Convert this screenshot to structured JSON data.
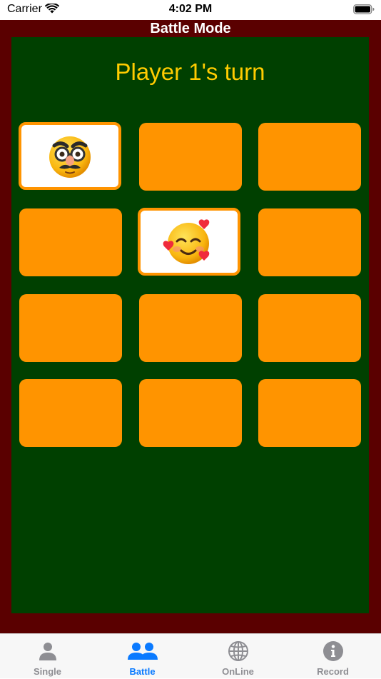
{
  "status_bar": {
    "carrier": "Carrier",
    "time": "4:02 PM"
  },
  "screen": {
    "title": "Battle Mode",
    "turn_text": "Player 1's turn"
  },
  "cards": [
    {
      "face_up": true,
      "emoji": "disguised-face"
    },
    {
      "face_up": false
    },
    {
      "face_up": false
    },
    {
      "face_up": false
    },
    {
      "face_up": true,
      "emoji": "smiling-face-with-hearts"
    },
    {
      "face_up": false
    },
    {
      "face_up": false
    },
    {
      "face_up": false
    },
    {
      "face_up": false
    },
    {
      "face_up": false
    },
    {
      "face_up": false
    },
    {
      "face_up": false
    }
  ],
  "tabs": [
    {
      "label": "Single",
      "icon": "person-icon",
      "active": false
    },
    {
      "label": "Battle",
      "icon": "people-icon",
      "active": true
    },
    {
      "label": "OnLine",
      "icon": "globe-icon",
      "active": false
    },
    {
      "label": "Record",
      "icon": "info-icon",
      "active": false
    }
  ],
  "colors": {
    "frame": "#5a0000",
    "board": "#004000",
    "card_back": "#ff9400",
    "turn_text": "#ffcc00",
    "tab_active": "#0a7aff",
    "tab_inactive": "#8e8e93"
  }
}
